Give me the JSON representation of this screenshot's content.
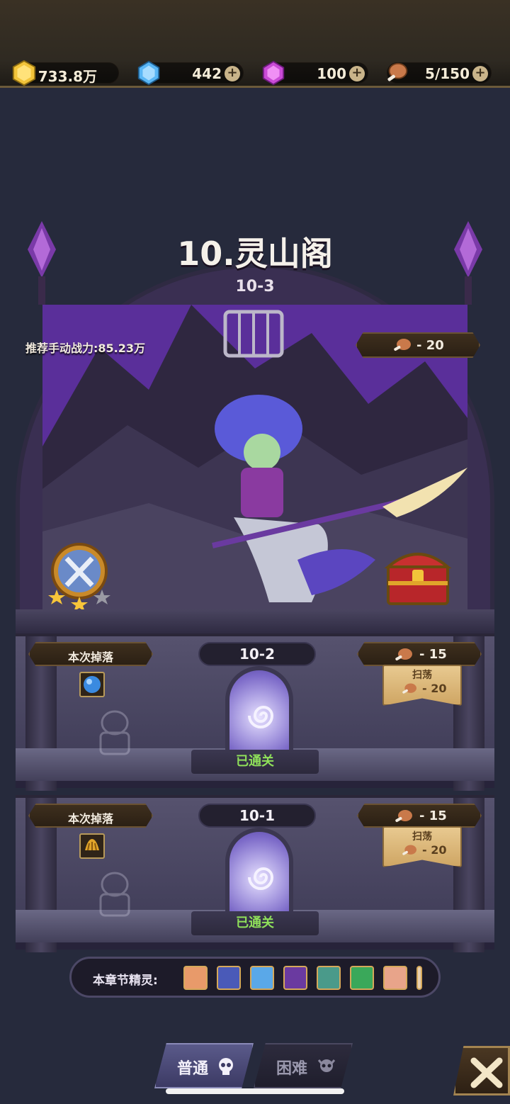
{
  "resources": [
    {
      "name": "gold",
      "value": "733.8万",
      "has_plus": false,
      "icon": "gold-icon",
      "color": "#f2c43a"
    },
    {
      "name": "diamond",
      "value": "442",
      "has_plus": true,
      "icon": "diamond-icon",
      "color": "#59b6f5"
    },
    {
      "name": "purple-gem",
      "value": "100",
      "has_plus": true,
      "icon": "purple-gem-icon",
      "color": "#c94ad6"
    },
    {
      "name": "stamina",
      "value": "5/150",
      "has_plus": true,
      "icon": "meat-icon",
      "color": "#c9794a"
    }
  ],
  "chapter": {
    "title": "10.灵山阁",
    "current_stage": "10-3",
    "recommended_power": "推荐手动战力:85.23万",
    "cost": "- 20",
    "stars": 3
  },
  "stages": [
    {
      "id": "10-2",
      "drop_label": "本次掉落",
      "drop_item": "blue-orb-icon",
      "cost": "- 15",
      "sweep_label": "扫荡",
      "sweep_cost": "- 20",
      "status": "已通关"
    },
    {
      "id": "10-1",
      "drop_label": "本次掉落",
      "drop_item": "claw-icon",
      "cost": "- 15",
      "sweep_label": "扫荡",
      "sweep_cost": "- 20",
      "status": "已通关"
    }
  ],
  "chapter_spirits": {
    "label": "本章节精灵:"
  },
  "mode_tabs": [
    {
      "label": "普通",
      "active": true
    },
    {
      "label": "困难",
      "active": false
    }
  ]
}
